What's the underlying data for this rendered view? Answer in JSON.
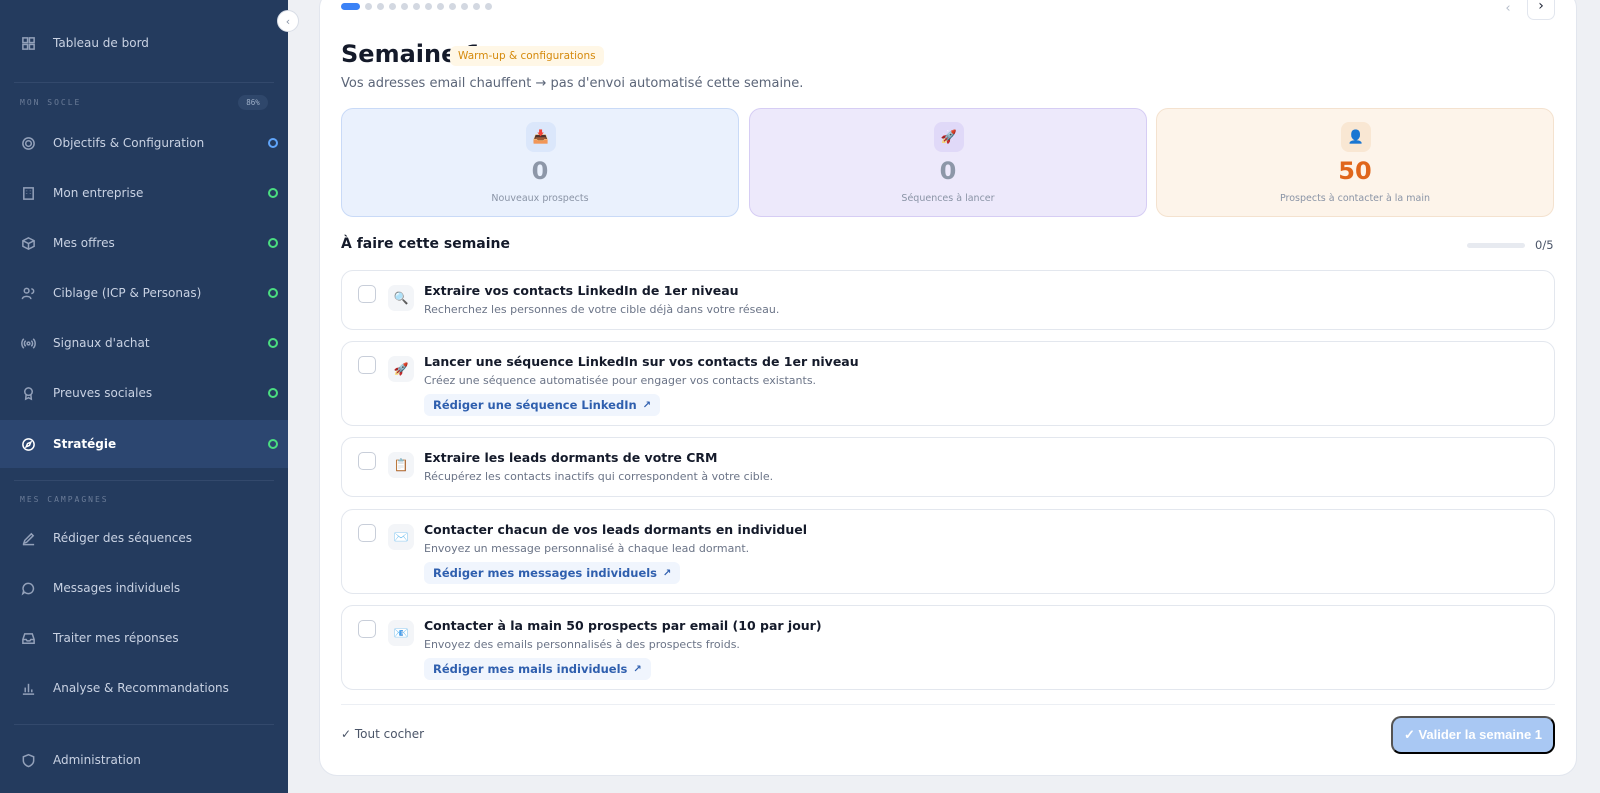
{
  "sidebar": {
    "dashboard": "Tableau de bord",
    "section_socle": "MON SOCLE",
    "socle_percent": "86%",
    "socle_items": [
      {
        "label": "Objectifs & Configuration",
        "icon": "target-icon",
        "status": "blue"
      },
      {
        "label": "Mon entreprise",
        "icon": "building-icon",
        "status": "green"
      },
      {
        "label": "Mes offres",
        "icon": "package-icon",
        "status": "green"
      },
      {
        "label": "Ciblage (ICP & Personas)",
        "icon": "users-icon",
        "status": "green"
      },
      {
        "label": "Signaux d'achat",
        "icon": "radio-icon",
        "status": "green"
      },
      {
        "label": "Preuves sociales",
        "icon": "award-icon",
        "status": "green"
      },
      {
        "label": "Stratégie",
        "icon": "compass-icon",
        "status": "green",
        "active": true
      }
    ],
    "section_campagnes": "MES CAMPAGNES",
    "campagne_items": [
      {
        "label": "Rédiger des séquences",
        "icon": "pencil-icon"
      },
      {
        "label": "Messages individuels",
        "icon": "chat-icon"
      },
      {
        "label": "Traiter mes réponses",
        "icon": "inbox-icon"
      },
      {
        "label": "Analyse & Recommandations",
        "icon": "bar-chart-icon"
      }
    ],
    "admin": "Administration"
  },
  "main": {
    "week_title": "Semaine 1",
    "week_badge": "Warm-up & configurations",
    "week_subtitle": "Vos adresses email chauffent → pas d'envoi automatisé cette semaine.",
    "stats": [
      {
        "value": "0",
        "label": "Nouveaux prospects",
        "icon": "📥"
      },
      {
        "value": "0",
        "label": "Séquences à lancer",
        "icon": "🚀"
      },
      {
        "value": "50",
        "label": "Prospects à contacter à la main",
        "icon": "👤"
      }
    ],
    "todo_title": "À faire cette semaine",
    "todo_count": "0/5",
    "todo_progress": 0,
    "tasks": [
      {
        "icon": "🔍",
        "title": "Extraire vos contacts LinkedIn de 1er niveau",
        "desc": "Recherchez les personnes de votre cible déjà dans votre réseau.",
        "link": ""
      },
      {
        "icon": "🚀",
        "title": "Lancer une séquence LinkedIn sur vos contacts de 1er niveau",
        "desc": "Créez une séquence automatisée pour engager vos contacts existants.",
        "link": "Rédiger une séquence LinkedIn"
      },
      {
        "icon": "📋",
        "title": "Extraire les leads dormants de votre CRM",
        "desc": "Récupérez les contacts inactifs qui correspondent à votre cible.",
        "link": ""
      },
      {
        "icon": "✉️",
        "title": "Contacter chacun de vos leads dormants en individuel",
        "desc": "Envoyez un message personnalisé à chaque lead dormant.",
        "link": "Rédiger mes messages individuels"
      },
      {
        "icon": "📧",
        "title": "Contacter à la main 50 prospects par email (10 par jour)",
        "desc": "Envoyez des emails personnalisés à des prospects froids.",
        "link": "Rédiger mes mails individuels"
      }
    ],
    "check_all": "✓ Tout cocher",
    "validate": "✓ Valider la semaine 1"
  }
}
